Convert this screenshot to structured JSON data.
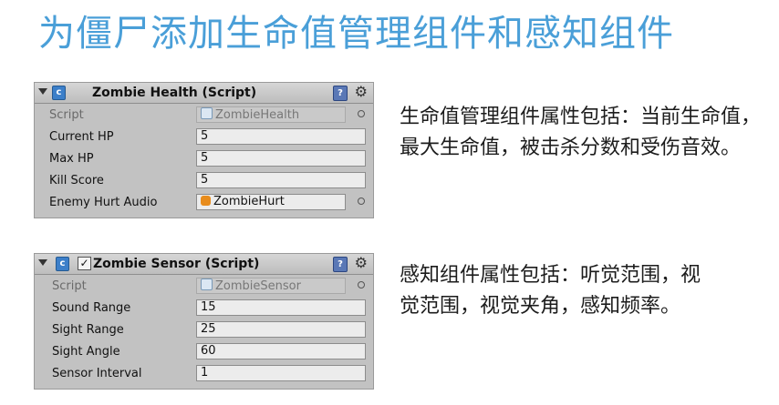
{
  "slide": {
    "title": "为僵尸添加生命值管理组件和感知组件"
  },
  "health_component": {
    "title": "Zombie Health (Script)",
    "script_label": "Script",
    "script_value": "ZombieHealth",
    "fields": [
      {
        "label": "Current HP",
        "value": "5"
      },
      {
        "label": "Max HP",
        "value": "5"
      },
      {
        "label": "Kill Score",
        "value": "5"
      }
    ],
    "audio_label": "Enemy Hurt Audio",
    "audio_value": "ZombieHurt",
    "description": "生命值管理组件属性包括：当前生命值，最大生命值，被击杀分数和受伤音效。"
  },
  "sensor_component": {
    "title": "Zombie Sensor (Script)",
    "enabled_mark": "✓",
    "script_label": "Script",
    "script_value": "ZombieSensor",
    "fields": [
      {
        "label": "Sound Range",
        "value": "15"
      },
      {
        "label": "Sight Range",
        "value": "25"
      },
      {
        "label": "Sight Angle",
        "value": "60"
      },
      {
        "label": "Sensor Interval",
        "value": "1"
      }
    ],
    "description": "感知组件属性包括：听觉范围，视觉范围，视觉夹角，感知频率。"
  },
  "icons": {
    "script_glyph": "c",
    "help_glyph": "?",
    "gear_glyph": "⚙"
  }
}
